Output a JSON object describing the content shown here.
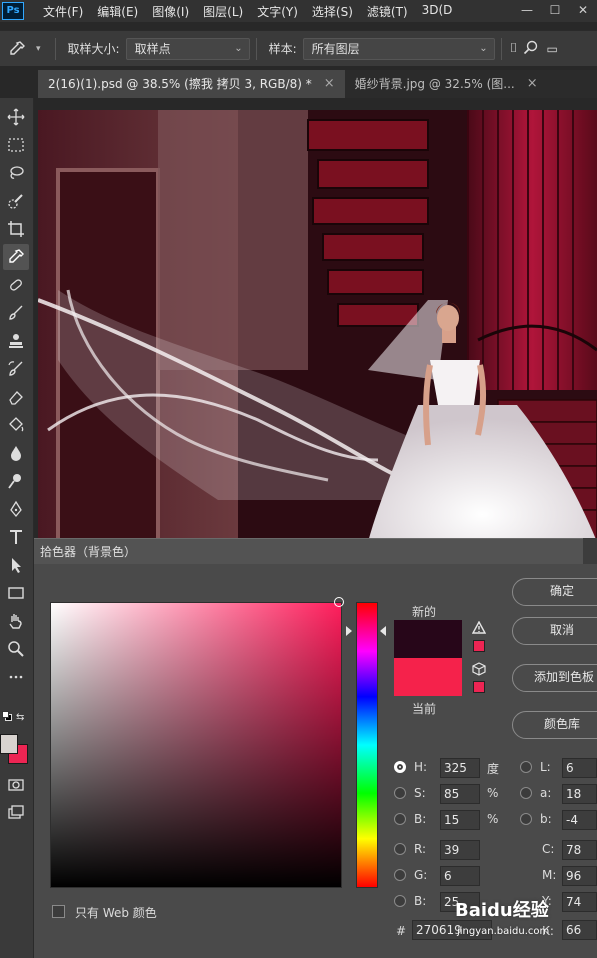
{
  "app": {
    "logo": "Ps",
    "menu": [
      "文件(F)",
      "编辑(E)",
      "图像(I)",
      "图层(L)",
      "文字(Y)",
      "选择(S)",
      "滤镜(T)",
      "3D(D"
    ],
    "window_buttons": [
      "—",
      "☐",
      "✕"
    ]
  },
  "options_bar": {
    "sample_size_label": "取样大小:",
    "sample_size_value": "取样点",
    "sample_label": "样本:",
    "sample_value": "所有图层"
  },
  "tabs": [
    {
      "label": "2(16)(1).psd @ 38.5% (擦我 拷贝 3, RGB/8) *",
      "close": "×"
    },
    {
      "label": "婚纱背景.jpg @ 32.5% (图...",
      "close": "×"
    }
  ],
  "tools": [
    "move-icon",
    "marquee-icon",
    "lasso-icon",
    "quick-select-icon",
    "crop-icon",
    "eyedropper-icon",
    "healing-icon",
    "brush-icon",
    "stamp-icon",
    "history-brush-icon",
    "eraser-icon",
    "bucket-icon",
    "blur-icon",
    "dodge-icon",
    "pen-icon",
    "type-icon",
    "path-select-icon",
    "rectangle-icon",
    "hand-icon",
    "zoom-icon",
    "more-icon"
  ],
  "colors": {
    "foreground": "#d8d3cf",
    "background": "#ed2553",
    "new_color": "#270619",
    "current_color": "#f5224b"
  },
  "dialog": {
    "title": "拾色器（背景色）",
    "new_label": "新的",
    "current_label": "当前",
    "buttons": {
      "ok": "确定",
      "cancel": "取消",
      "add_to_swatches": "添加到色板",
      "color_libraries": "颜色库"
    },
    "hsb": {
      "h_label": "H:",
      "h_value": "325",
      "h_unit": "度",
      "s_label": "S:",
      "s_value": "85",
      "s_unit": "%",
      "b_label": "B:",
      "b_value": "15",
      "b_unit": "%"
    },
    "rgb": {
      "r_label": "R:",
      "r_value": "39",
      "g_label": "G:",
      "g_value": "6",
      "b_label": "B:",
      "b_value": "25"
    },
    "lab": {
      "l_label": "L:",
      "l_value": "6",
      "a_label": "a:",
      "a_value": "18",
      "b_label": "b:",
      "b_value": "-4"
    },
    "cmyk": {
      "c_label": "C:",
      "c_value": "78",
      "m_label": "M:",
      "m_value": "96",
      "y_label": "Y:",
      "y_value": "74",
      "k_label": "K:",
      "k_value": "66"
    },
    "hex_label": "#",
    "hex_value": "270619",
    "web_only_label": "只有 Web 颜色"
  },
  "watermark": {
    "brand": "Baidu经验",
    "url": "jingyan.baidu.com"
  }
}
